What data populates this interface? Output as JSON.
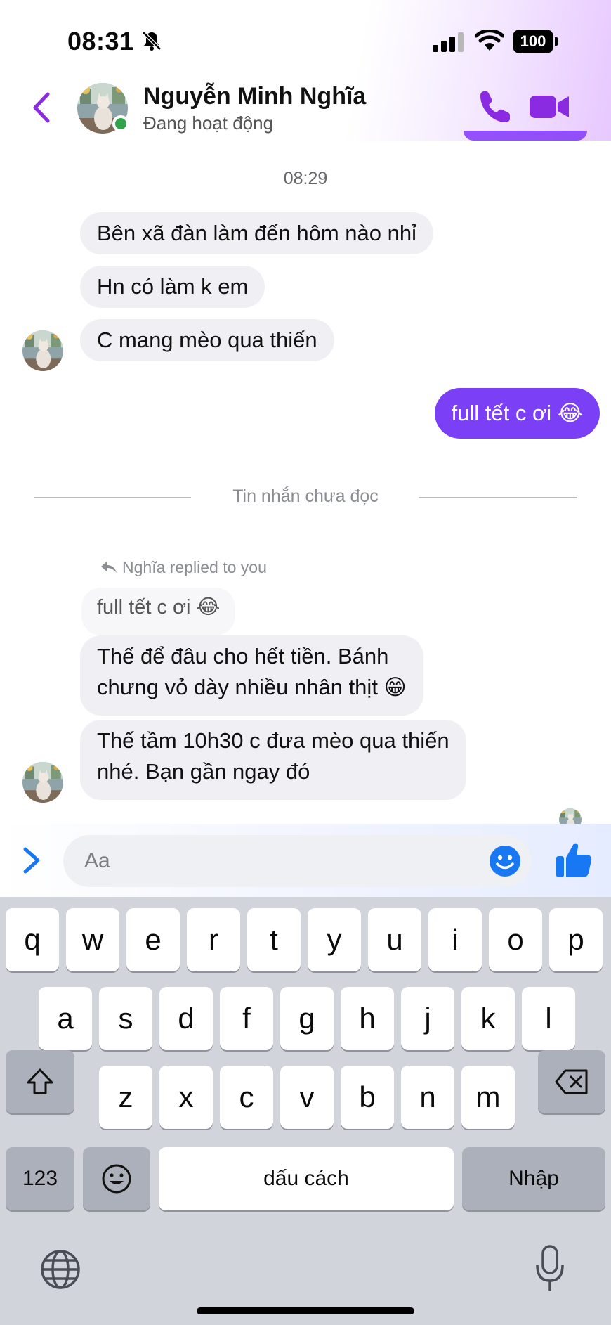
{
  "status_bar": {
    "time": "08:31",
    "battery": "100"
  },
  "header": {
    "name": "Nguyễn Minh Nghĩa",
    "status": "Đang hoạt động"
  },
  "messages": {
    "timestamp": "08:29",
    "incoming_1": "Bên xã đàn làm đến hôm nào nhỉ",
    "incoming_2": "Hn có làm k em",
    "incoming_3": "C mang mèo qua thiến",
    "outgoing_1": "full tết c ơi 😂",
    "unread_divider": "Tin nhắn chưa đọc",
    "reply_label": "Nghĩa replied to you",
    "quoted_text": "full tết c ơi 😂",
    "incoming_4_line1": "Thế để đâu cho hết tiền. Bánh",
    "incoming_4_line2": "chưng vỏ dày nhiều nhân thịt 😁",
    "incoming_5_line1": "Thế tầm 10h30 c đưa mèo qua thiến",
    "incoming_5_line2": "nhé. Bạn gần ngay đó"
  },
  "composer": {
    "placeholder": "Aa"
  },
  "keyboard": {
    "row1": [
      "q",
      "w",
      "e",
      "r",
      "t",
      "y",
      "u",
      "i",
      "o",
      "p"
    ],
    "row2": [
      "a",
      "s",
      "d",
      "f",
      "g",
      "h",
      "j",
      "k",
      "l"
    ],
    "row3": [
      "z",
      "x",
      "c",
      "v",
      "b",
      "n",
      "m"
    ],
    "numbers": "123",
    "space": "dấu cách",
    "return": "Nhập"
  },
  "colors": {
    "accent": "#7b3ff5",
    "header_icon": "#8a2be2",
    "like": "#1877f2",
    "online": "#31a24c"
  },
  "icons": [
    "mute-icon",
    "signal-icon",
    "wifi-icon",
    "back-icon",
    "phone-icon",
    "video-icon",
    "reply-arrow-icon",
    "expand-icon",
    "emoji-icon",
    "like-icon",
    "shift-icon",
    "backspace-icon",
    "emoji-key-icon",
    "globe-icon",
    "mic-icon"
  ]
}
